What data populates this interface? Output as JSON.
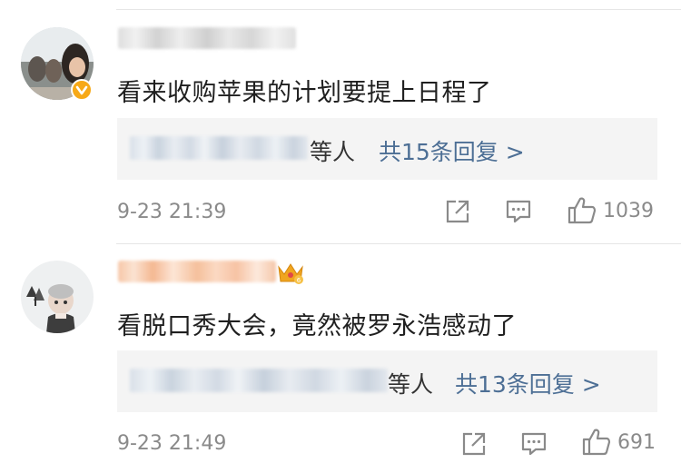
{
  "comments": [
    {
      "text": "看来收购苹果的计划要提上日程了",
      "reply_others": "等人",
      "reply_count_label": "共15条回复 >",
      "timestamp": "9-23 21:39",
      "likes": "1039",
      "verified": true
    },
    {
      "text": "看脱口秀大会，竟然被罗永浩感动了",
      "reply_others": "等人",
      "reply_count_label": "共13条回复 >",
      "timestamp": "9-23 21:49",
      "likes": "691",
      "crown_badge": true
    }
  ],
  "icons": {
    "share": "share-icon",
    "comment": "comment-icon",
    "like": "thumbs-up-icon",
    "verified": "verified-badge-icon",
    "crown": "crown-badge-icon"
  },
  "colors": {
    "text": "#1f1f1f",
    "link": "#4d6f95",
    "meta": "#8a8a8a",
    "reply_bg": "#f4f4f4",
    "verified": "#f7a917"
  }
}
